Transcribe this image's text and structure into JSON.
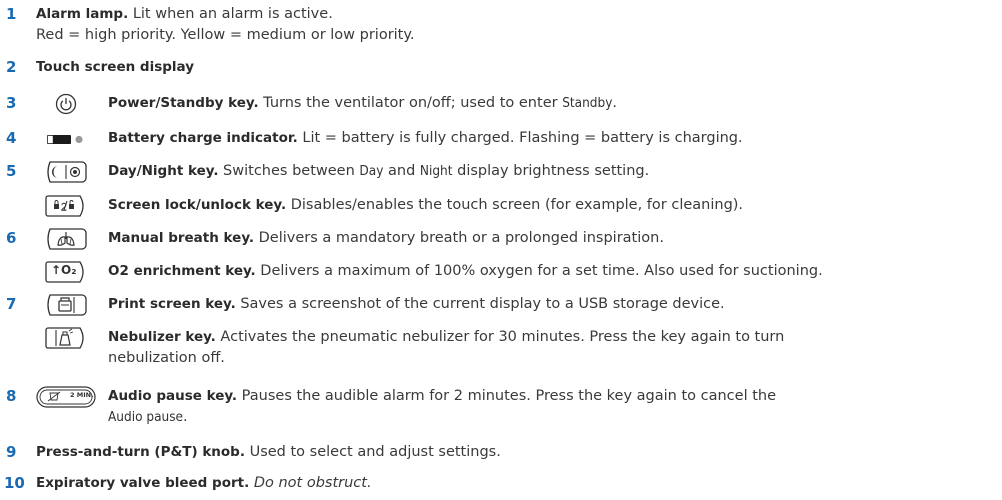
{
  "items": [
    {
      "number": "1",
      "title": "Alarm lamp.",
      "desc": " Lit when an alarm is active.",
      "desc2": "Red = high priority. Yellow = medium or low priority.",
      "icon": ""
    },
    {
      "number": "2",
      "title": "Touch screen display",
      "desc": "",
      "icon": ""
    },
    {
      "number": "3",
      "title": "Power/Standby key.",
      "desc_pre": " Turns the ventilator on/off; used to enter ",
      "mode": "Standby",
      "desc_post": ".",
      "icon": "power-icon"
    },
    {
      "number": "4",
      "title": "Battery charge indicator.",
      "desc": " Lit = battery is fully charged. Flashing = battery is charging.",
      "icon": "battery-icon"
    },
    {
      "number": "5",
      "title": "Day/Night key.",
      "desc_pre": " Switches between ",
      "mode1": "Day",
      "desc_mid": " and ",
      "mode2": "Night",
      "desc_post": " display brightness setting.",
      "icon": "day-night-icon"
    },
    {
      "number": "",
      "title": "Screen lock/unlock key.",
      "desc": " Disables/enables the touch screen (for example, for cleaning).",
      "icon": "lock-icon"
    },
    {
      "number": "6",
      "title": "Manual breath key.",
      "desc": " Delivers a mandatory breath or a prolonged inspiration.",
      "icon": "lungs-icon"
    },
    {
      "number": "",
      "title": "O2 enrichment key.",
      "desc": " Delivers a maximum of 100% oxygen for a set time. Also used for suctioning.",
      "icon": "o2-icon",
      "icon_text": "↑O₂"
    },
    {
      "number": "7",
      "title": "Print screen key.",
      "desc": " Saves a screenshot of the current display to a USB storage device.",
      "icon": "print-icon"
    },
    {
      "number": "",
      "title": "Nebulizer key.",
      "desc": " Activates the pneumatic nebulizer for 30 minutes. Press the key again to turn",
      "desc2": "nebulization off.",
      "icon": "nebulizer-icon"
    },
    {
      "number": "8",
      "title": "Audio pause key.",
      "desc": " Pauses the audible alarm for 2 minutes. Press the key again to cancel the",
      "mode": "Audio pause",
      "desc_post": ".",
      "icon": "audio-pause-icon",
      "icon_text": "2 MIN."
    },
    {
      "number": "9",
      "title": "Press-and-turn (P&T) knob.",
      "desc": " Used to select and adjust settings.",
      "icon": ""
    },
    {
      "number": "10",
      "title": "Expiratory valve bleed port.",
      "desc": " ",
      "em": "Do not obstruct.",
      "icon": ""
    }
  ]
}
